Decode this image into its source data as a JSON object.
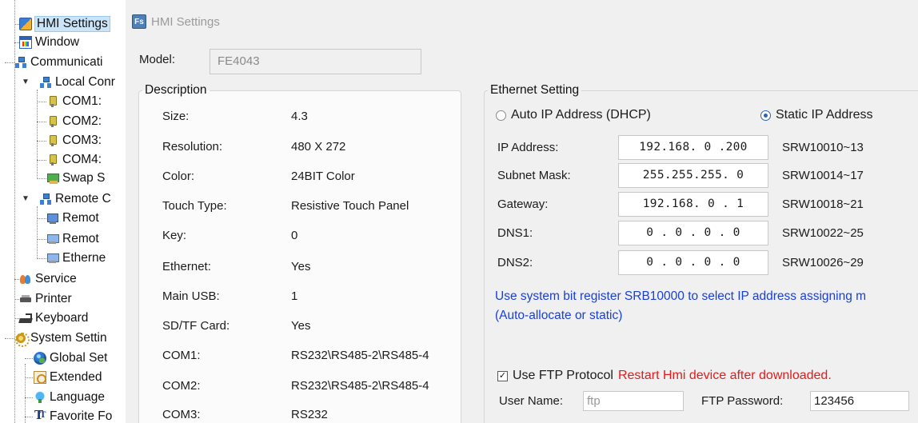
{
  "tree": {
    "items": [
      {
        "label": "HMI Settings",
        "icon": "hmi-settings-icon",
        "level": 1,
        "selected": true
      },
      {
        "label": "Window",
        "icon": "window-icon",
        "level": 1
      },
      {
        "label": "Communicati",
        "icon": "communication-icon",
        "level": 1
      },
      {
        "label": "Local Conr",
        "icon": "local-connection-icon",
        "level": 2
      },
      {
        "label": "COM1:",
        "icon": "com-port-icon",
        "level": 3
      },
      {
        "label": "COM2:",
        "icon": "com-port-icon",
        "level": 3
      },
      {
        "label": "COM3:",
        "icon": "com-port-icon",
        "level": 3
      },
      {
        "label": "COM4:",
        "icon": "com-port-icon",
        "level": 3
      },
      {
        "label": "Swap S",
        "icon": "swap-icon",
        "level": 3
      },
      {
        "label": "Remote C",
        "icon": "remote-connection-icon",
        "level": 2
      },
      {
        "label": "Remot",
        "icon": "remote-pc-icon",
        "level": 3
      },
      {
        "label": "Remot",
        "icon": "remote-hmi-icon",
        "level": 3
      },
      {
        "label": "Etherne",
        "icon": "ethernet-icon",
        "level": 3
      },
      {
        "label": "Service",
        "icon": "service-icon",
        "level": 1
      },
      {
        "label": "Printer",
        "icon": "printer-icon",
        "level": 1
      },
      {
        "label": "Keyboard",
        "icon": "keyboard-icon",
        "level": 1
      },
      {
        "label": "System Settin",
        "icon": "system-settings-icon",
        "level": 0
      },
      {
        "label": "Global Set",
        "icon": "global-settings-icon",
        "level": 1
      },
      {
        "label": "Extended",
        "icon": "extended-icon",
        "level": 1
      },
      {
        "label": "Language",
        "icon": "language-icon",
        "level": 1
      },
      {
        "label": "Favorite Fo",
        "icon": "favorite-font-icon",
        "level": 1
      }
    ]
  },
  "panel": {
    "title": "HMI Settings",
    "title_icon_text": "Fs",
    "model_label": "Model:",
    "model_value": "FE4043"
  },
  "description": {
    "legend": "Description",
    "rows": [
      {
        "key": "Size:",
        "value": "4.3"
      },
      {
        "key": "Resolution:",
        "value": "480 X 272"
      },
      {
        "key": "Color:",
        "value": "24BIT Color"
      },
      {
        "key": "Touch Type:",
        "value": "Resistive Touch Panel"
      },
      {
        "key": "Key:",
        "value": "0"
      },
      {
        "key": "Ethernet:",
        "value": "Yes"
      },
      {
        "key": "Main USB:",
        "value": "1"
      },
      {
        "key": "SD/TF Card:",
        "value": "Yes"
      },
      {
        "key": "COM1:",
        "value": "RS232\\RS485-2\\RS485-4"
      },
      {
        "key": "COM2:",
        "value": "RS232\\RS485-2\\RS485-4"
      },
      {
        "key": "COM3:",
        "value": "RS232"
      }
    ]
  },
  "ethernet": {
    "legend": "Ethernet Setting",
    "radio_dhcp": "Auto IP Address (DHCP)",
    "radio_static": "Static IP Address",
    "selected": "static",
    "fields": [
      {
        "key": "IP Address:",
        "value": "192.168. 0 .200",
        "register": "SRW10010~13"
      },
      {
        "key": "Subnet Mask:",
        "value": "255.255.255. 0",
        "register": "SRW10014~17"
      },
      {
        "key": "Gateway:",
        "value": "192.168. 0 . 1",
        "register": "SRW10018~21"
      },
      {
        "key": "DNS1:",
        "value": "0 . 0 . 0 . 0",
        "register": "SRW10022~25"
      },
      {
        "key": "DNS2:",
        "value": "0 . 0 . 0 . 0",
        "register": "SRW10026~29"
      }
    ],
    "note_line1": "Use system bit register SRB10000 to select IP address assigning m",
    "note_line2": "(Auto-allocate or static)",
    "ftp_label": "Use FTP Protocol",
    "ftp_checked": true,
    "ftp_warning": "Restart Hmi device after downloaded.",
    "username_label": "User Name:",
    "username_value": "ftp",
    "password_label": "FTP Password:",
    "password_value": "123456",
    "note_color": "#1a3fd6",
    "warning_color": "#e21b1b"
  }
}
